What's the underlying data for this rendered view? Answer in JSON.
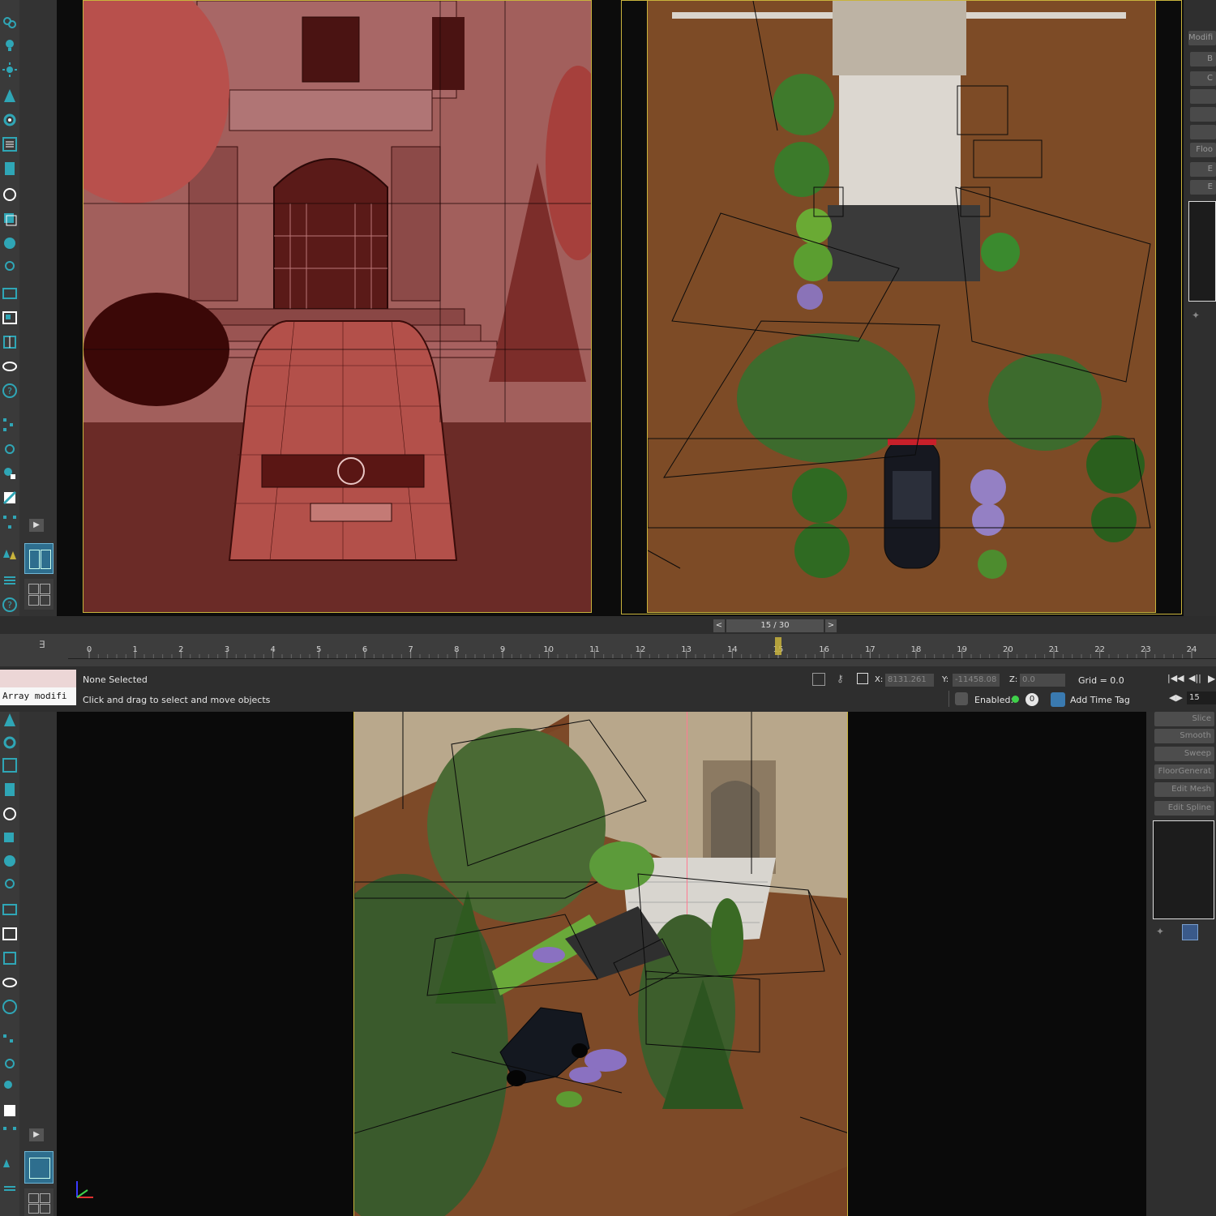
{
  "timeline": {
    "frame_label": "15 / 30",
    "prev": "<",
    "next": ">",
    "ticks": [
      "0",
      "1",
      "2",
      "3",
      "4",
      "5",
      "6",
      "7",
      "8",
      "9",
      "10",
      "11",
      "12",
      "13",
      "14",
      "15",
      "16",
      "17",
      "18",
      "19",
      "20",
      "21",
      "22",
      "23",
      "24"
    ],
    "current_frame": 15
  },
  "status": {
    "selection": "None Selected",
    "hint": "Click and drag to select and move objects",
    "listener": "Array modifi"
  },
  "coords": {
    "x_label": "X:",
    "x_value": "8131.261",
    "y_label": "Y:",
    "y_value": "-11458.08",
    "z_label": "Z:",
    "z_value": "0.0",
    "grid": "Grid = 0.0"
  },
  "time_controls": {
    "enabled_label": "Enabled:",
    "add_time_tag": "Add Time Tag",
    "frame_field": "15",
    "badge": "0"
  },
  "right_panel_top": {
    "tab": "Modifi",
    "items": [
      "B",
      "C",
      "Floo",
      "E",
      "E"
    ]
  },
  "modifier_list": [
    "Slice",
    "Smooth",
    "Sweep",
    "FloorGenerat",
    "Edit Mesh",
    "Edit Spline"
  ],
  "colors": {
    "frame": "#c8b33c",
    "accent": "#2fa6b6",
    "wire_bg": "#6b2b27",
    "dirt": "#7a4a25",
    "grass": "#3f6b2c"
  }
}
